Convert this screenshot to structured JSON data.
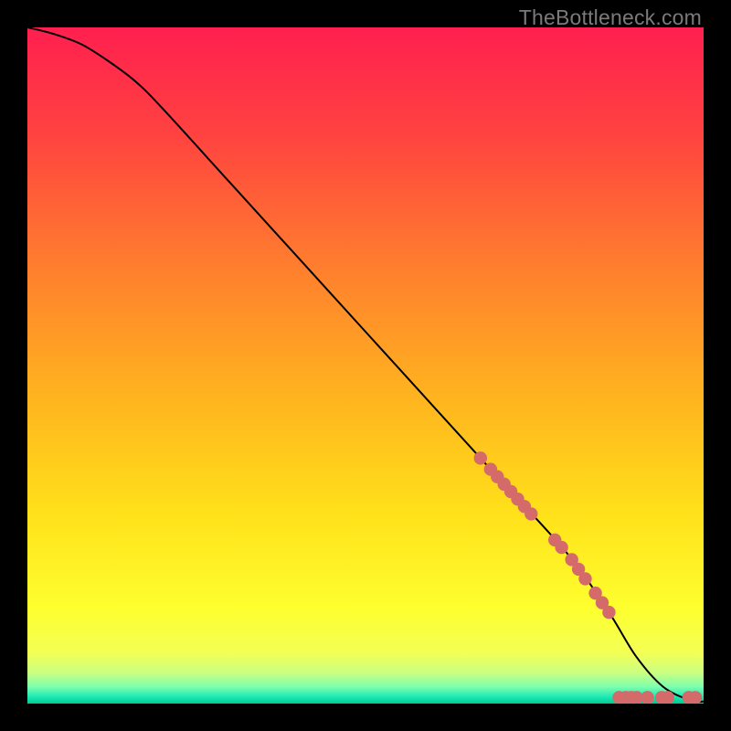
{
  "watermark": "TheBottleneck.com",
  "colors": {
    "dot": "#d46a6a",
    "curve": "#000000",
    "gradient_stops": [
      {
        "offset": 0.0,
        "color": "#ff1f4f"
      },
      {
        "offset": 0.16,
        "color": "#ff4340"
      },
      {
        "offset": 0.34,
        "color": "#ff7a2f"
      },
      {
        "offset": 0.54,
        "color": "#ffb21f"
      },
      {
        "offset": 0.72,
        "color": "#ffe11a"
      },
      {
        "offset": 0.86,
        "color": "#feff2e"
      },
      {
        "offset": 0.925,
        "color": "#f3ff55"
      },
      {
        "offset": 0.955,
        "color": "#c9ff83"
      },
      {
        "offset": 0.975,
        "color": "#7effac"
      },
      {
        "offset": 0.99,
        "color": "#1de9b6"
      },
      {
        "offset": 1.0,
        "color": "#00c98f"
      }
    ]
  },
  "chart_data": {
    "type": "line",
    "title": "",
    "xlabel": "",
    "ylabel": "",
    "xlim": [
      0,
      100
    ],
    "ylim": [
      0,
      100
    ],
    "series": [
      {
        "name": "curve",
        "x": [
          0,
          4,
          8,
          12,
          16,
          20,
          30,
          40,
          50,
          60,
          70,
          80,
          86,
          90,
          94,
          98,
          100
        ],
        "y": [
          100,
          99,
          97.5,
          95,
          92,
          88,
          77,
          66,
          55,
          44,
          33,
          22,
          13.5,
          7,
          2.5,
          0.5,
          0.3
        ]
      }
    ],
    "dots_on_curve_x": [
      67,
      68.5,
      69.5,
      70.5,
      71.5,
      72.5,
      73.5,
      74.5,
      78,
      79,
      80.5,
      81.5,
      82.5,
      84,
      85,
      86
    ],
    "dots_flat_x": [
      87.5,
      88.5,
      89.3,
      90.1,
      91.7,
      93.8,
      94.7,
      97.8,
      98.8
    ],
    "dot_flat_y": 0.9
  }
}
